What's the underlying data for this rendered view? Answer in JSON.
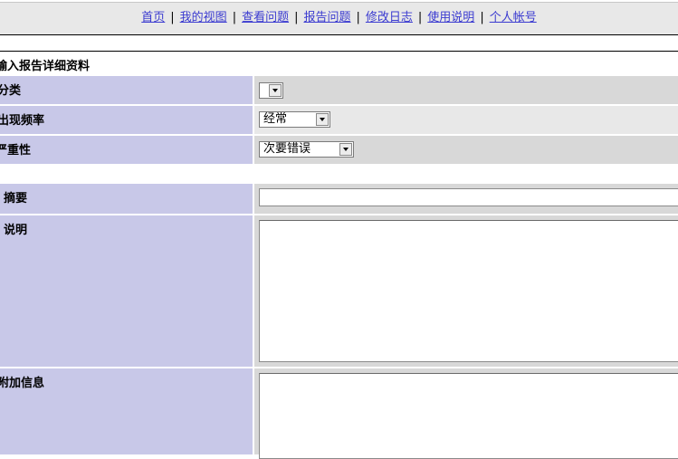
{
  "nav": {
    "links": [
      {
        "label": "首页"
      },
      {
        "label": "我的视图"
      },
      {
        "label": "查看问题"
      },
      {
        "label": "报告问题"
      },
      {
        "label": "修改日志"
      },
      {
        "label": "使用说明"
      },
      {
        "label": "个人帐号"
      }
    ],
    "separator": "|"
  },
  "form": {
    "title": "输入报告详细资料",
    "category": {
      "label": "分类",
      "value": ""
    },
    "reproducibility": {
      "label": "出现频率",
      "value": "经常"
    },
    "severity": {
      "label": "严重性",
      "value": "次要错误"
    },
    "summary": {
      "label": "摘要",
      "value": ""
    },
    "description": {
      "label": "说明",
      "value": ""
    },
    "additional_info": {
      "label": "附加信息",
      "value": ""
    }
  }
}
